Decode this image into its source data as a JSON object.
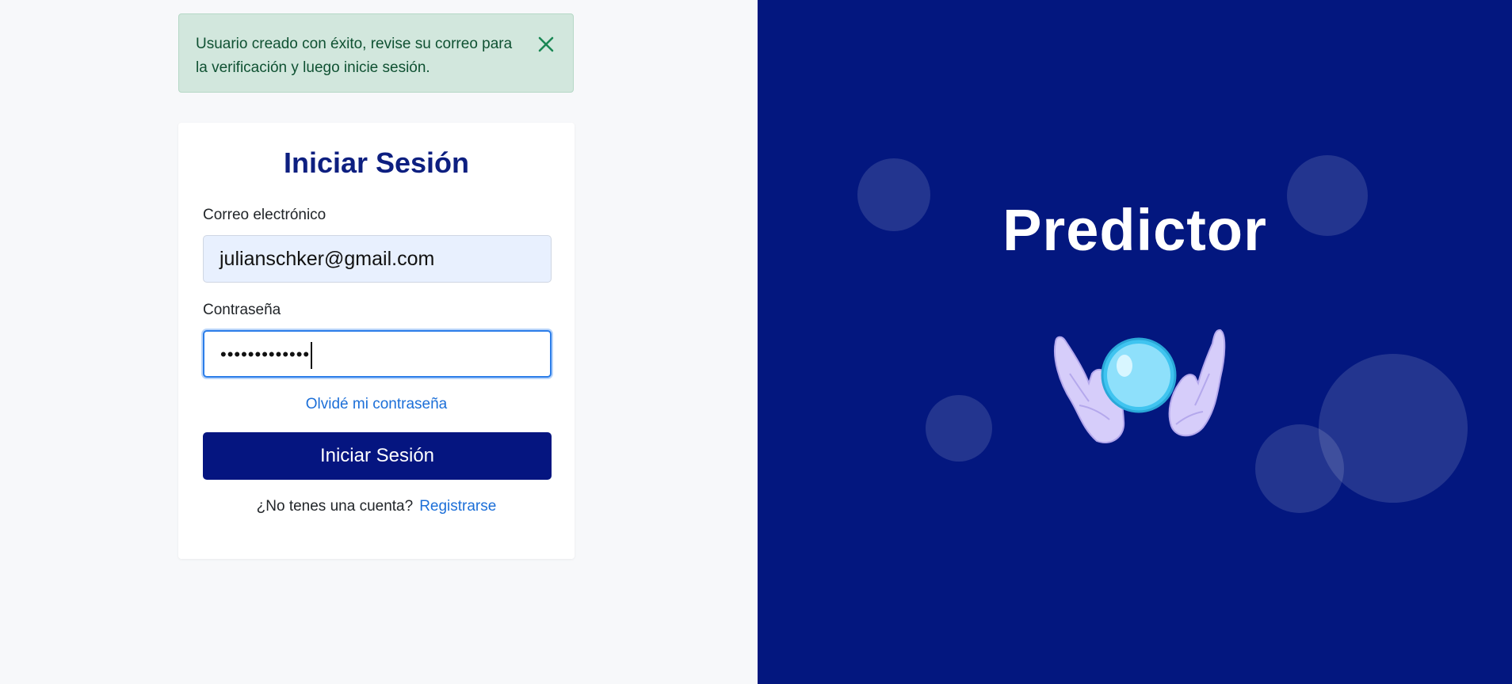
{
  "alert": {
    "message": "Usuario creado con éxito, revise su correo para la verificación y luego inicie sesión.",
    "close_icon": "close-icon",
    "color": "#0f5132",
    "background": "#d2e7dd"
  },
  "login": {
    "title": "Iniciar Sesión",
    "email_label": "Correo electrónico",
    "email_value": "julianschker@gmail.com",
    "password_label": "Contraseña",
    "password_value": "•••••••••••••",
    "forgot_link": "Olvidé mi contraseña",
    "submit_label": "Iniciar Sesión",
    "no_account_text": "¿No tenes una cuenta?",
    "register_link": "Registrarse"
  },
  "brand": {
    "title": "Predictor",
    "illustration_icon": "crystal-ball-hands-icon",
    "panel_color": "#03177f"
  },
  "colors": {
    "primary": "#051580",
    "link": "#1c6fd8",
    "title": "#0d1f80"
  }
}
